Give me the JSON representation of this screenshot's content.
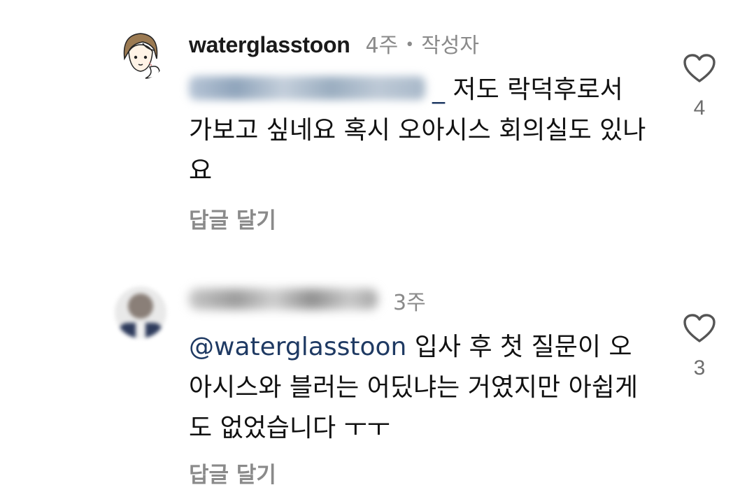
{
  "comments": [
    {
      "username": "waterglasstoon",
      "time": "4주",
      "separator": "•",
      "author_badge": "작성자",
      "mention_suffix": "_",
      "text": "저도 락덕후로서 가보고 싶네요 혹시 오아시스 회의실도 있나요",
      "reply_label": "답글 달기",
      "like_icon": "heart-outline-icon",
      "like_count": "4"
    },
    {
      "time": "3주",
      "mention": "@waterglasstoon",
      "text": "입사 후 첫 질문이 오아시스와 블러는 어딨냐는 거였지만 아쉽게도 없었습니다 ㅜㅜ",
      "reply_label": "답글 달기",
      "like_icon": "heart-outline-icon",
      "like_count": "3"
    }
  ],
  "colors": {
    "mention": "#1f3a63",
    "secondary_text": "#8a8a8a",
    "primary_text": "#111111"
  }
}
